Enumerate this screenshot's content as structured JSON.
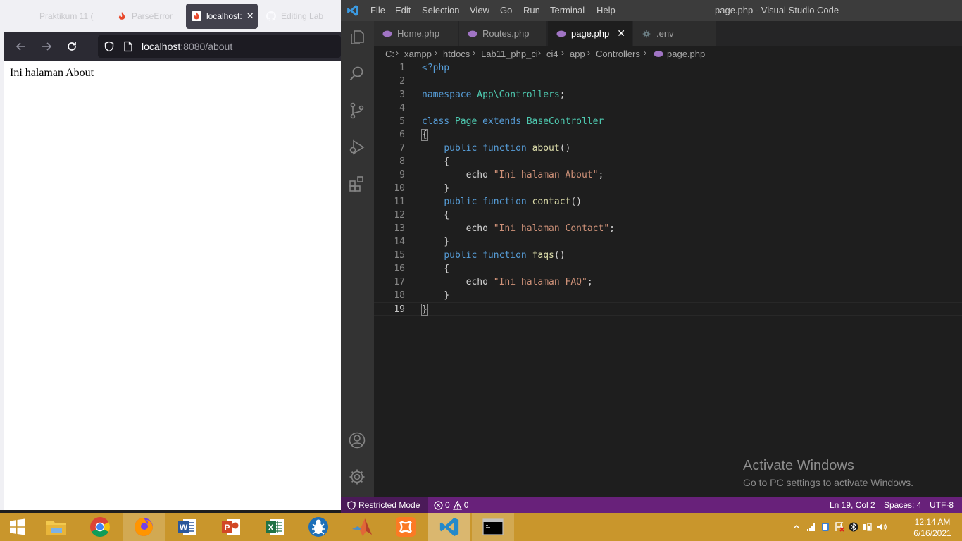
{
  "browser": {
    "tabs": [
      {
        "label": "Praktikum 11 (",
        "icon": "blank-tab-icon",
        "active": false
      },
      {
        "label": "ParseError",
        "icon": "codeigniter-icon",
        "active": false
      },
      {
        "label": "localhost:",
        "icon": "codeigniter-icon",
        "active": true
      },
      {
        "label": "Editing Lab",
        "icon": "github-icon",
        "active": false
      }
    ],
    "url_host": "localhost",
    "url_rest": ":8080/about",
    "page_text": "Ini halaman About"
  },
  "vscode": {
    "menu": [
      "File",
      "Edit",
      "Selection",
      "View",
      "Go",
      "Run",
      "Terminal",
      "Help"
    ],
    "window_title": "page.php - Visual Studio Code",
    "tabs": [
      {
        "label": "Home.php",
        "icon": "php-icon",
        "active": false
      },
      {
        "label": "Routes.php",
        "icon": "php-icon",
        "active": false
      },
      {
        "label": "page.php",
        "icon": "php-icon",
        "active": true
      },
      {
        "label": ".env",
        "icon": "gear-icon",
        "active": false
      }
    ],
    "breadcrumbs": [
      "C:",
      "xampp",
      "htdocs",
      "Lab11_php_ci",
      "ci4",
      "app",
      "Controllers",
      "page.php"
    ],
    "code_lines": [
      "<?php",
      "",
      "namespace App\\Controllers;",
      "",
      "class Page extends BaseController",
      "{",
      "    public function about()",
      "    {",
      "        echo \"Ini halaman About\";",
      "    }",
      "    public function contact()",
      "    {",
      "        echo \"Ini halaman Contact\";",
      "    }",
      "    public function faqs()",
      "    {",
      "        echo \"Ini halaman FAQ\";",
      "    }",
      "}"
    ],
    "status": {
      "restricted": "Restricted Mode",
      "errors": "0",
      "warnings": "0",
      "position": "Ln 19, Col 2",
      "spaces": "Spaces: 4",
      "encoding": "UTF-8"
    },
    "watermark_title": "Activate Windows",
    "watermark_sub": "Go to PC settings to activate Windows."
  },
  "taskbar": {
    "apps": [
      "windows-start-icon",
      "file-explorer-icon",
      "chrome-icon",
      "firefox-icon",
      "word-icon",
      "powerpoint-icon",
      "excel-icon",
      "bug-app-icon",
      "matlab-icon",
      "xampp-icon",
      "vscode-icon",
      "cmd-icon"
    ],
    "time": "12:14 AM",
    "date": "6/16/2021"
  },
  "colors": {
    "vscode_status": "#68217a",
    "taskbar": "#c9962c",
    "firefox_toolbar": "#2b2a33"
  }
}
